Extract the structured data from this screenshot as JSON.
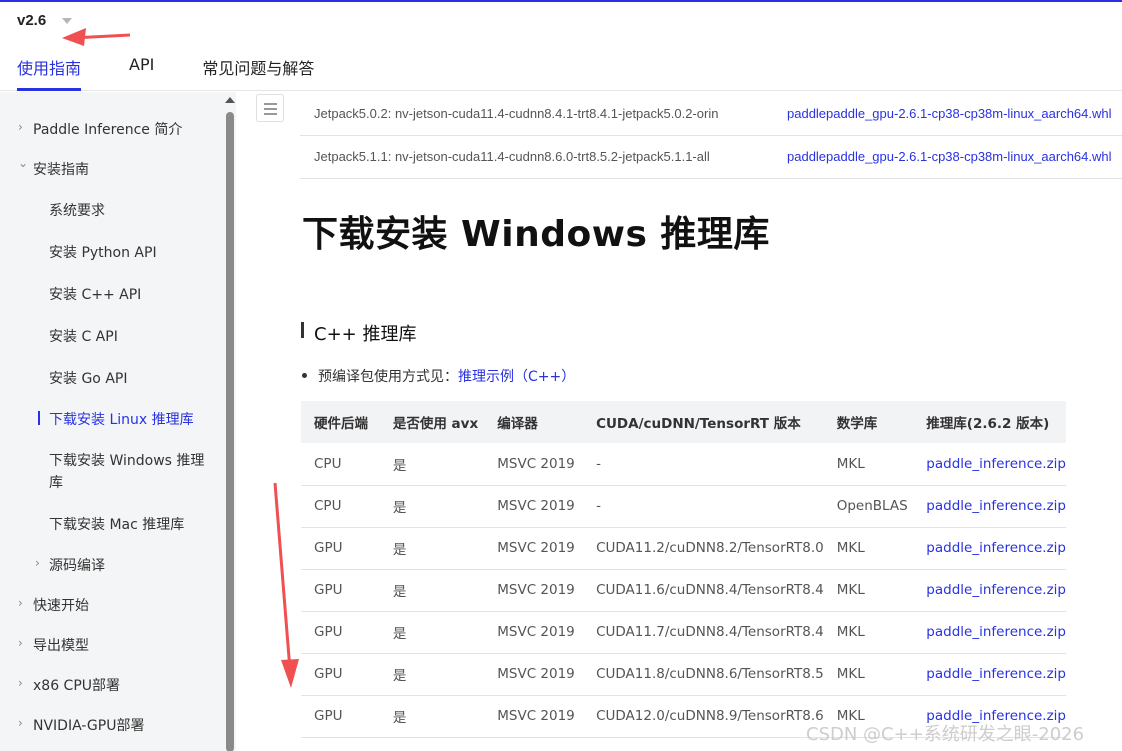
{
  "header": {
    "version": "v2.6",
    "tabs": [
      "使用指南",
      "API",
      "常见问题与解答"
    ]
  },
  "sidebar": {
    "items": [
      {
        "label": "Paddle Inference 简介",
        "chevron": "›"
      },
      {
        "label": "安装指南",
        "chevron": "⌄"
      },
      {
        "label": "系统要求"
      },
      {
        "label": "安装 Python API"
      },
      {
        "label": "安装 C++ API"
      },
      {
        "label": "安装 C API"
      },
      {
        "label": "安装 Go API"
      },
      {
        "label": "下载安装 Linux 推理库"
      },
      {
        "label": "下载安装 Windows 推理库"
      },
      {
        "label": "下载安装 Mac 推理库"
      },
      {
        "label": "源码编译",
        "chevron": "›"
      },
      {
        "label": "快速开始",
        "chevron": "›"
      },
      {
        "label": "导出模型",
        "chevron": "›"
      },
      {
        "label": "x86 CPU部署",
        "chevron": "›"
      },
      {
        "label": "NVIDIA-GPU部署",
        "chevron": "›"
      }
    ],
    "windows_label_line1": "下载安装 Windows 推理",
    "windows_label_line2": "库"
  },
  "jetson_rows": [
    {
      "env": "Jetpack5.0.2: nv-jetson-cuda11.4-cudnn8.4.1-trt8.4.1-jetpack5.0.2-orin",
      "file": "paddlepaddle_gpu-2.6.1-cp38-cp38m-linux_aarch64.whl"
    },
    {
      "env": "Jetpack5.1.1: nv-jetson-cuda11.4-cudnn8.6.0-trt8.5.2-jetpack5.1.1-all",
      "file": "paddlepaddle_gpu-2.6.1-cp38-cp38m-linux_aarch64.whl"
    }
  ],
  "main": {
    "title": "下载安装 Windows 推理库",
    "section": "C++ 推理库",
    "bullet_text": "预编译包使用方式见：",
    "bullet_link": "推理示例（C++）"
  },
  "win_table": {
    "headers": [
      "硬件后端",
      "是否使用 avx",
      "编译器",
      "CUDA/cuDNN/TensorRT 版本",
      "数学库",
      "推理库(2.6.2 版本)"
    ],
    "rows": [
      [
        "CPU",
        "是",
        "MSVC 2019",
        "-",
        "MKL",
        "paddle_inference.zip"
      ],
      [
        "CPU",
        "是",
        "MSVC 2019",
        "-",
        "OpenBLAS",
        "paddle_inference.zip"
      ],
      [
        "GPU",
        "是",
        "MSVC 2019",
        "CUDA11.2/cuDNN8.2/TensorRT8.0",
        "MKL",
        "paddle_inference.zip"
      ],
      [
        "GPU",
        "是",
        "MSVC 2019",
        "CUDA11.6/cuDNN8.4/TensorRT8.4",
        "MKL",
        "paddle_inference.zip"
      ],
      [
        "GPU",
        "是",
        "MSVC 2019",
        "CUDA11.7/cuDNN8.4/TensorRT8.4",
        "MKL",
        "paddle_inference.zip"
      ],
      [
        "GPU",
        "是",
        "MSVC 2019",
        "CUDA11.8/cuDNN8.6/TensorRT8.5",
        "MKL",
        "paddle_inference.zip"
      ],
      [
        "GPU",
        "是",
        "MSVC 2019",
        "CUDA12.0/cuDNN8.9/TensorRT8.6",
        "MKL",
        "paddle_inference.zip"
      ]
    ]
  },
  "watermark": "CSDN @C++系统研发之眼-2026",
  "colors": {
    "accent": "#2932e1",
    "annotation_arrow": "#f05050",
    "sidebar_bg": "#f4f5f6"
  }
}
